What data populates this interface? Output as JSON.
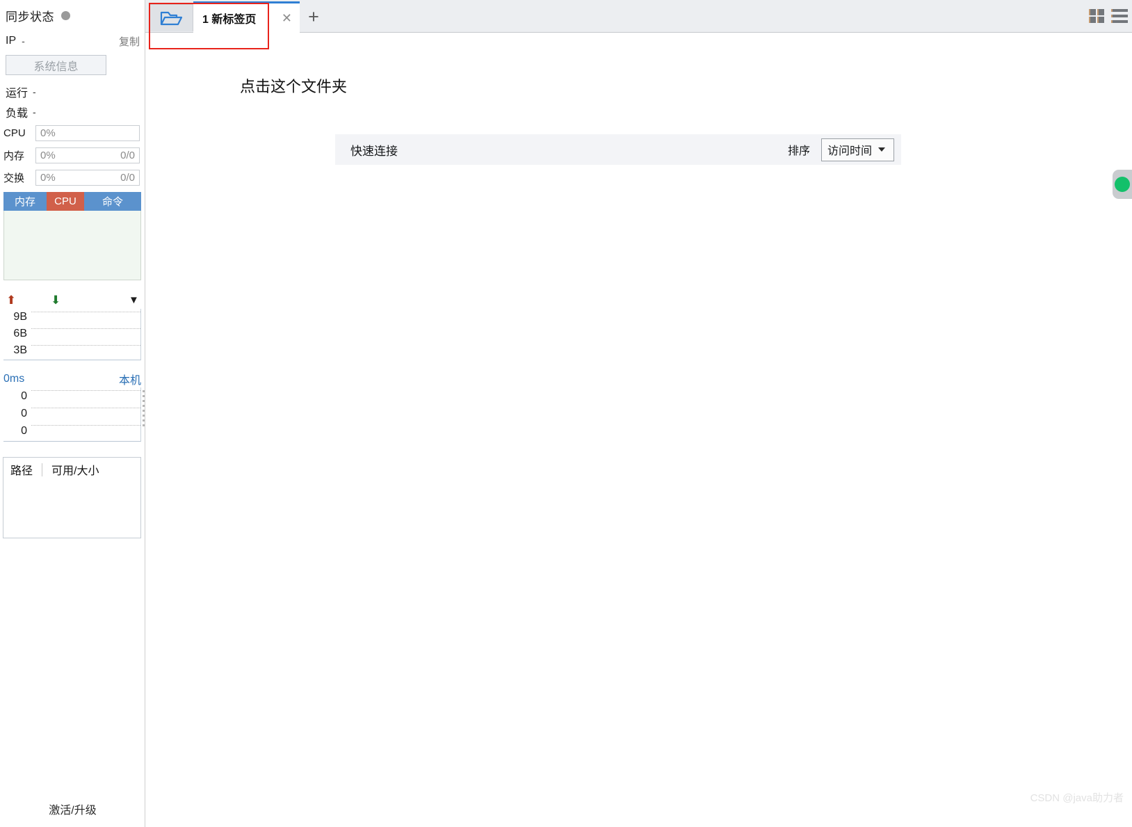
{
  "sidebar": {
    "sync": {
      "label": "同步状态",
      "status_icon": "status-dot",
      "status_color": "#9a9a9a"
    },
    "ip": {
      "key": "IP",
      "value": "-",
      "copy_label": "复制"
    },
    "system_info_button": "系统信息",
    "uptime": {
      "key": "运行",
      "value": "-"
    },
    "load": {
      "key": "负载",
      "value": "-"
    },
    "meters": [
      {
        "key": "CPU",
        "percent": "0%",
        "detail": ""
      },
      {
        "key": "内存",
        "percent": "0%",
        "detail": "0/0"
      },
      {
        "key": "交换",
        "percent": "0%",
        "detail": "0/0"
      }
    ],
    "mini_tabs": [
      {
        "label": "内存",
        "active": false,
        "color": "#5b92cd"
      },
      {
        "label": "CPU",
        "active": true,
        "color": "#d1604a"
      },
      {
        "label": "命令",
        "active": false,
        "color": "#5b92cd"
      }
    ],
    "network": {
      "upload_icon": "arrow-up-icon",
      "download_icon": "arrow-down-icon",
      "menu_icon": "caret-down-icon",
      "y_labels": [
        "9B",
        "6B",
        "3B"
      ]
    },
    "latency": {
      "value": "0ms",
      "host": "本机",
      "y_labels": [
        "0",
        "0",
        "0"
      ]
    },
    "disk": {
      "col_path": "路径",
      "col_size": "可用/大小",
      "rows": []
    },
    "activate_label": "激活/升级"
  },
  "tabbar": {
    "folder_icon": "folder-open-icon",
    "tabs": [
      {
        "title": "1 新标签页",
        "close_icon": "close-icon",
        "active": true
      }
    ],
    "new_tab_icon": "plus-icon",
    "grid_icon": "grid-view-icon",
    "menu_icon": "hamburger-menu-icon"
  },
  "main": {
    "heading": "点击这个文件夹",
    "quick_connect": {
      "title": "快速连接",
      "sort_label": "排序",
      "sort_value": "访问时间",
      "sort_caret_icon": "caret-down-icon",
      "options": [
        "访问时间"
      ]
    },
    "edge_pill": {
      "icon": "status-circle-icon",
      "color": "#13c06a"
    }
  },
  "annotation": {
    "shape": "rectangle",
    "color": "#e8231b"
  },
  "watermark": "CSDN @java助力者"
}
